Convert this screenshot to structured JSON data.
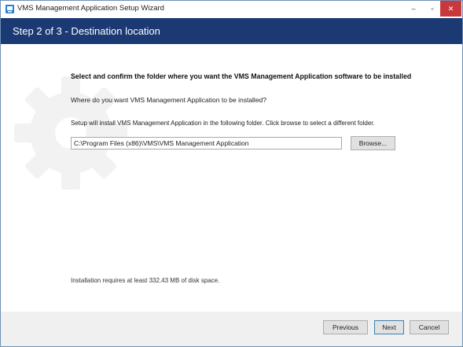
{
  "window": {
    "title": "VMS Management Application Setup Wizard",
    "controls": {
      "minimize": "–",
      "maximize": "▫",
      "close": "✕"
    }
  },
  "header": {
    "title": "Step 2 of 3 - Destination location",
    "color": "#1b3a74"
  },
  "content": {
    "heading": "Select and confirm the folder where you want the VMS Management Application software to be installed",
    "question": "Where do you want VMS Management Application to be installed?",
    "instruction": "Setup will install VMS Management Application in the following folder. Click browse to select a different folder.",
    "path_value": "C:\\Program Files (x86)\\VMS\\VMS Management Application",
    "browse_label": "Browse...",
    "space_required": "Installation requires at least 332.43 MB of disk space."
  },
  "footer": {
    "previous_label": "Previous",
    "next_label": "Next",
    "cancel_label": "Cancel"
  },
  "icons": {
    "app": "installer-icon",
    "background": "gear-icon"
  }
}
